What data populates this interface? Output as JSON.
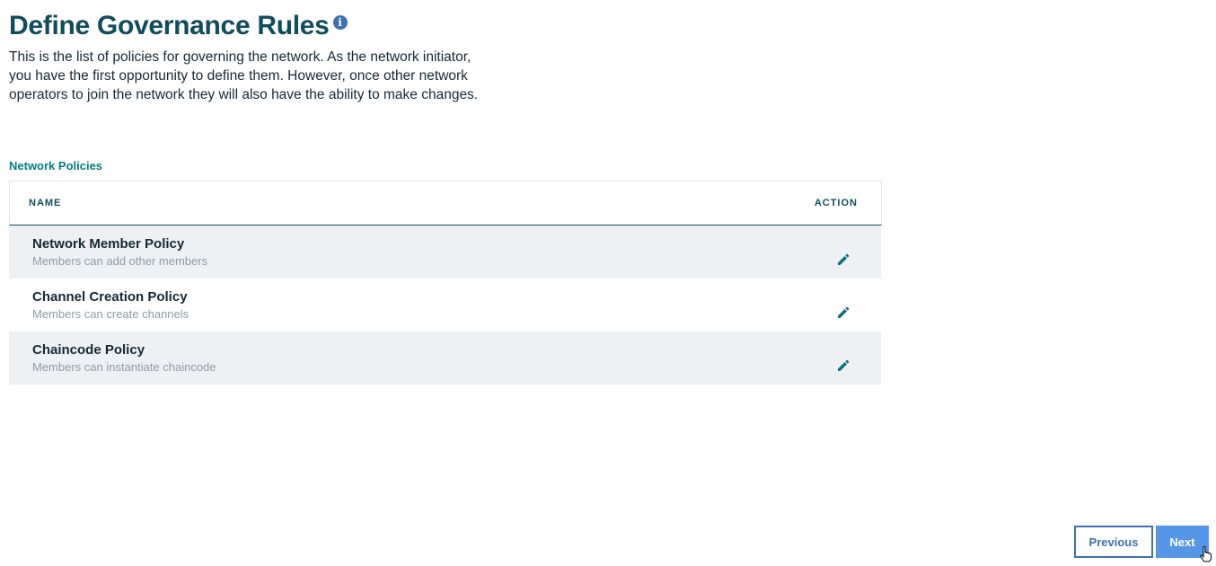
{
  "header": {
    "title": "Define Governance Rules",
    "info_icon": "info-icon",
    "description": "This is the list of policies for governing the network. As the network initiator, you have the first opportunity to define them. However, once other network operators to join the network they will also have the ability to make changes."
  },
  "policies": {
    "section_label": "Network Policies",
    "columns": [
      "NAME",
      "ACTION"
    ],
    "rows": [
      {
        "name": "Network Member Policy",
        "description": "Members can add other members",
        "action_icon": "pencil-edit-icon"
      },
      {
        "name": "Channel Creation Policy",
        "description": "Members can create channels",
        "action_icon": "pencil-edit-icon"
      },
      {
        "name": "Chaincode Policy",
        "description": "Members can instantiate chaincode",
        "action_icon": "pencil-edit-icon"
      }
    ]
  },
  "footer": {
    "previous_label": "Previous",
    "next_label": "Next"
  },
  "colors": {
    "title": "#0f4c5c",
    "accent_teal": "#007d80",
    "primary_blue": "#3d70b2",
    "next_button": "#5596e6",
    "row_shade": "#eef1f4"
  }
}
